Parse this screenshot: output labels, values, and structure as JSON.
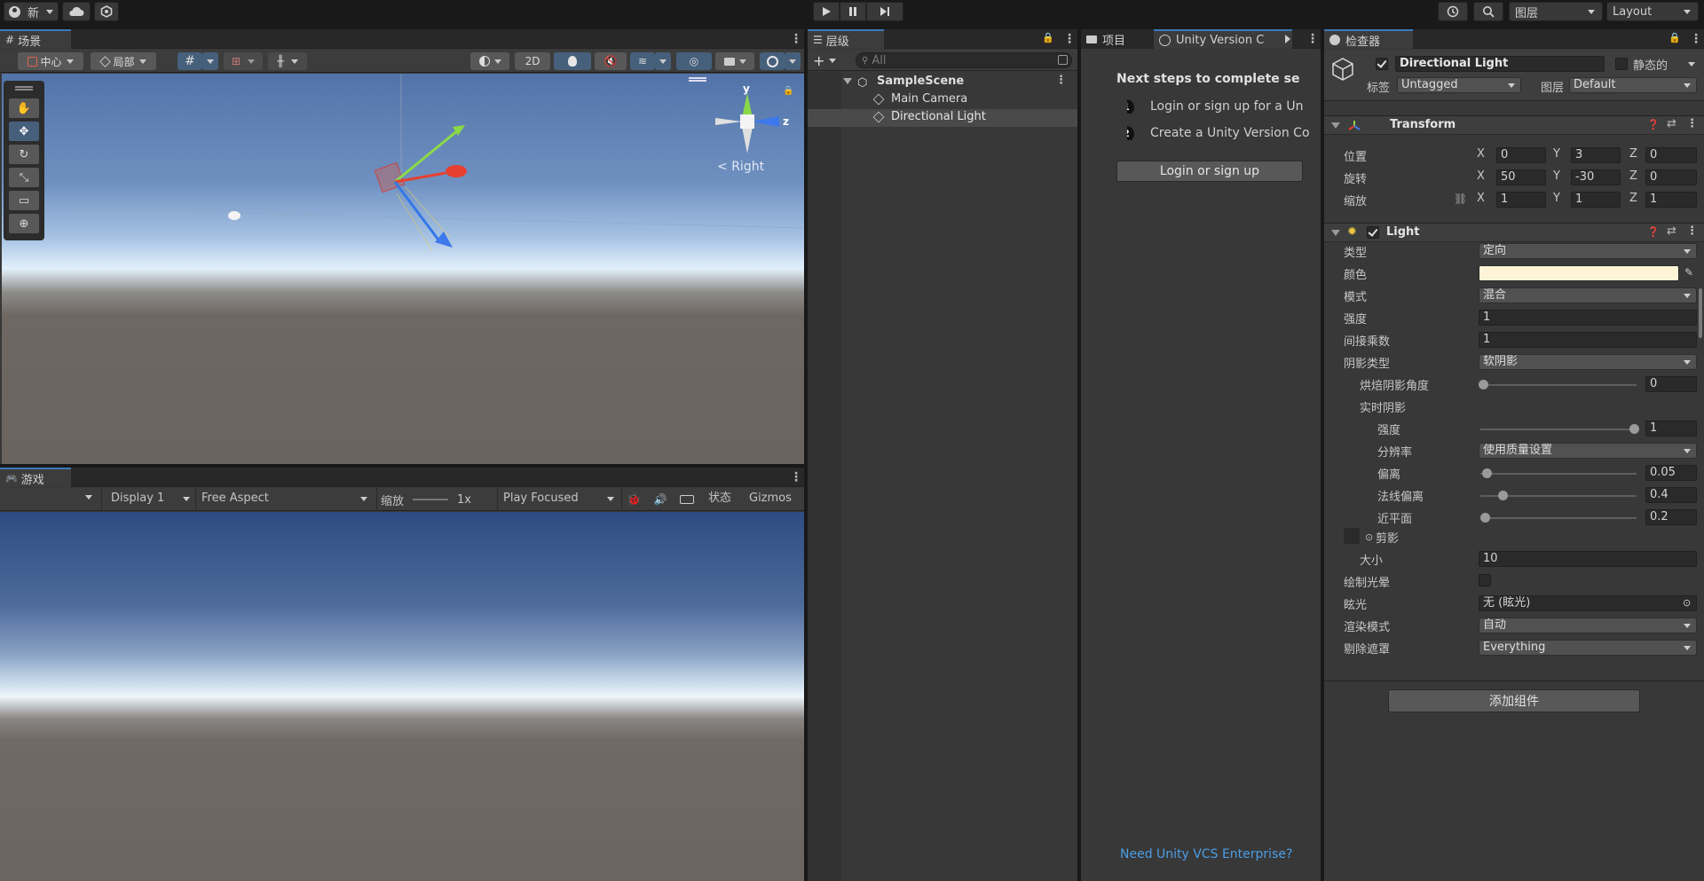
{
  "topbar": {
    "account_label": "新",
    "layers_label": "图层",
    "layout_label": "Layout"
  },
  "scene": {
    "tab_label": "场景",
    "pivot_label": "中心",
    "space_label": "局部",
    "twod_label": "2D",
    "gizmo_view_label": "Right",
    "gizmo_y": "y",
    "gizmo_z": "z"
  },
  "game": {
    "tab_label": "游戏",
    "display_label": "Display 1",
    "aspect_label": "Free Aspect",
    "scale_label": "缩放",
    "scale_value": "1x",
    "play_mode_label": "Play Focused",
    "stats_label": "状态",
    "gizmos_label": "Gizmos"
  },
  "hierarchy": {
    "tab_label": "层级",
    "search_placeholder": "All",
    "scene_name": "SampleScene",
    "items": [
      {
        "label": "Main Camera"
      },
      {
        "label": "Directional Light"
      }
    ]
  },
  "project": {
    "tab_label": "项目",
    "vcs_tab_label": "Unity Version C",
    "heading": "Next steps to complete se",
    "steps": [
      {
        "num": "1",
        "text": "Login or sign up for a Un"
      },
      {
        "num": "2",
        "text": "Create a Unity Version Co"
      }
    ],
    "login_button": "Login or sign up",
    "enterprise_link": "Need Unity VCS Enterprise?"
  },
  "inspector": {
    "tab_label": "检查器",
    "object_name": "Directional Light",
    "static_label": "静态的",
    "tag_label": "标签",
    "tag_value": "Untagged",
    "layer_label": "图层",
    "layer_value": "Default",
    "transform": {
      "title": "Transform",
      "position_label": "位置",
      "rotation_label": "旋转",
      "scale_label": "缩放",
      "axis_x": "X",
      "axis_y": "Y",
      "axis_z": "Z",
      "position": [
        "0",
        "3",
        "0"
      ],
      "rotation": [
        "50",
        "-30",
        "0"
      ],
      "scale": [
        "1",
        "1",
        "1"
      ]
    },
    "light": {
      "title": "Light",
      "type_label": "类型",
      "type_value": "定向",
      "color_label": "颜色",
      "color_hex": "#fff4d6",
      "mode_label": "模式",
      "mode_value": "混合",
      "intensity_label": "强度",
      "intensity_value": "1",
      "indirect_label": "间接乘数",
      "indirect_value": "1",
      "shadow_type_label": "阴影类型",
      "shadow_type_value": "软阴影",
      "baked_angle_label": "烘焙阴影角度",
      "baked_angle_value": "0",
      "realtime_label": "实时阴影",
      "strength_label": "强度",
      "strength_value": "1",
      "resolution_label": "分辨率",
      "resolution_value": "使用质量设置",
      "bias_label": "偏离",
      "bias_value": "0.05",
      "normal_bias_label": "法线偏离",
      "normal_bias_value": "0.4",
      "near_plane_label": "近平面",
      "near_plane_value": "0.2",
      "cookie_label": "剪影",
      "size_label": "大小",
      "size_value": "10",
      "halo_label": "绘制光晕",
      "flare_label": "眩光",
      "flare_value": "无 (眩光)",
      "render_mode_label": "渲染模式",
      "render_mode_value": "自动",
      "culling_label": "剔除遮罩",
      "culling_value": "Everything"
    },
    "add_component": "添加组件"
  },
  "colors": {
    "accent": "#3a79bb",
    "selection": "#2c5d87",
    "link": "#4c9de6"
  }
}
